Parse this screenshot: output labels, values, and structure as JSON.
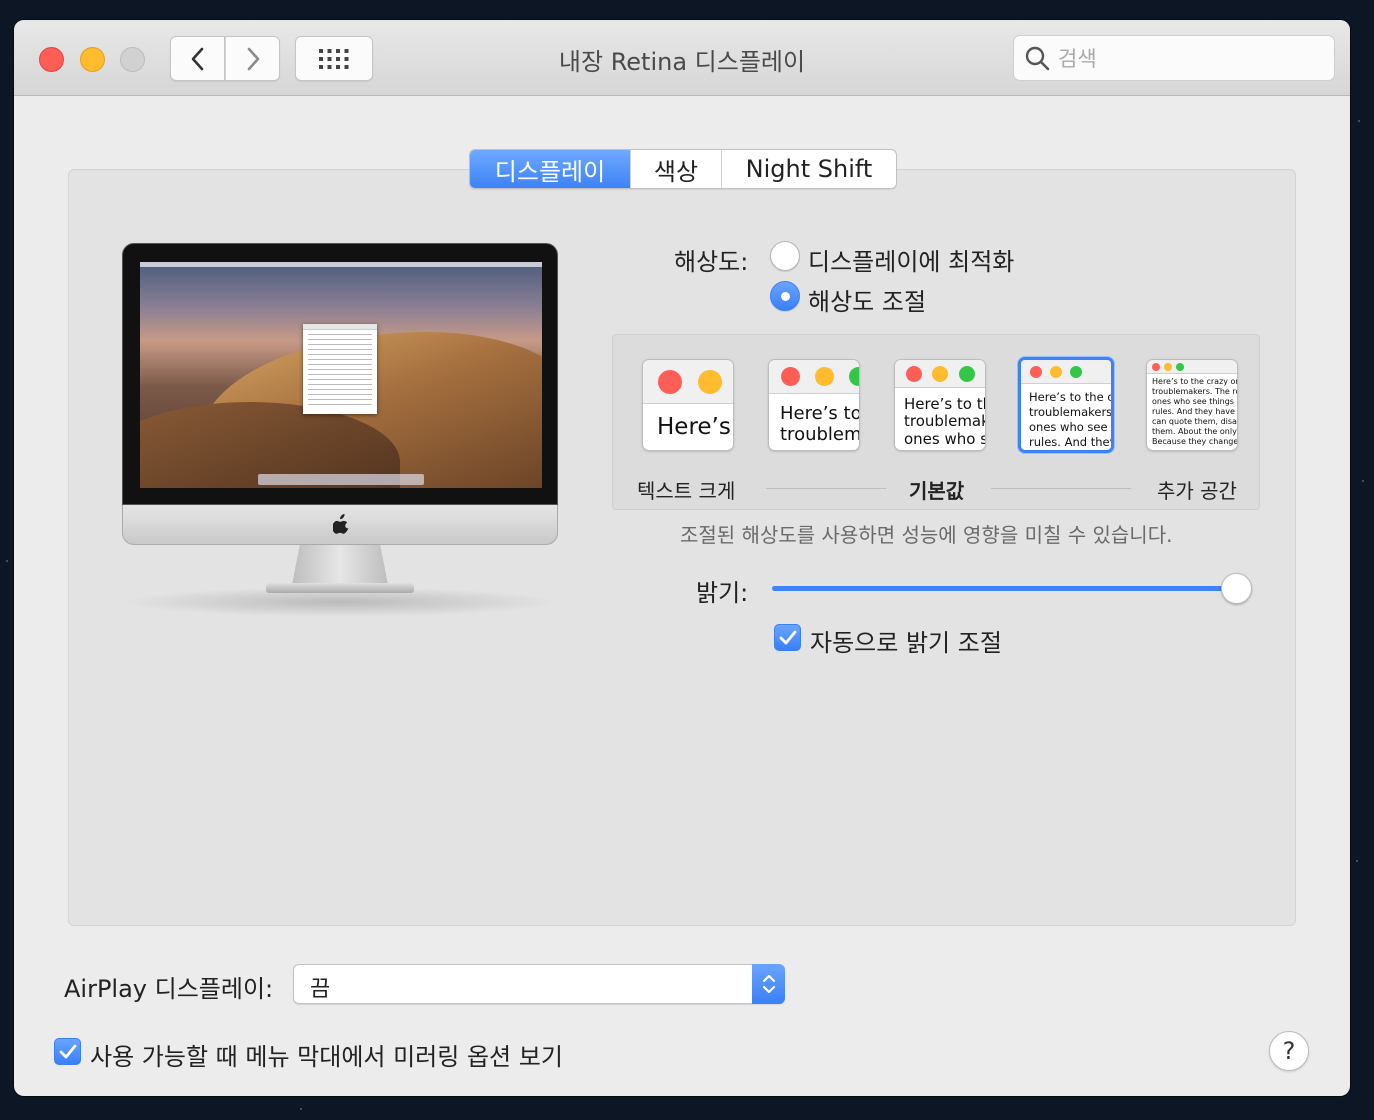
{
  "window": {
    "title": "내장 Retina 디스플레이",
    "search_placeholder": "검색"
  },
  "tabs": [
    {
      "label": "디스플레이",
      "active": true
    },
    {
      "label": "색상",
      "active": false
    },
    {
      "label": "Night Shift",
      "active": false
    }
  ],
  "resolution": {
    "label": "해상도:",
    "options": [
      {
        "label": "디스플레이에 최적화",
        "selected": false
      },
      {
        "label": "해상도 조절",
        "selected": true
      }
    ]
  },
  "scaling": {
    "thumbnails": [
      {
        "text": "Here’s",
        "selected": false
      },
      {
        "text": "Here’s to\ntroublem",
        "selected": false
      },
      {
        "text": "Here’s to th\ntroublemak\nones who s",
        "selected": false
      },
      {
        "text": "Here’s to the cr\ntroublemakers.\nones who see t\nrules. And they",
        "selected": true
      },
      {
        "text": "Here’s to the crazy one\ntroublemakers. The rou\nones who see things dil\nrules. And they have no\ncan quote them, disagr\nthem. About the only th\nBecause they change th",
        "selected": false
      }
    ],
    "label_left": "텍스트 크게",
    "label_center": "기본값",
    "label_right": "추가 공간"
  },
  "performance_note": "조절된 해상도를 사용하면 성능에 영향을 미칠 수 있습니다.",
  "brightness": {
    "label": "밝기:",
    "value": 1.0,
    "auto_label": "자동으로 밝기 조절",
    "auto_checked": true
  },
  "airplay": {
    "label": "AirPlay 디스플레이:",
    "value": "끔"
  },
  "mirroring": {
    "label": "사용 가능할 때 메뉴 막대에서 미러링 옵션 보기",
    "checked": true
  },
  "help_label": "?",
  "colors": {
    "accent": "#3d82f6",
    "close": "#fd5f57",
    "minimize": "#febc2e",
    "zoom_disabled": "#d1d1d1",
    "thumb_green": "#33c748"
  },
  "icons": [
    "back-chevron-icon",
    "forward-chevron-icon",
    "grid-icon",
    "search-icon",
    "apple-logo-icon",
    "checkmark-icon",
    "updown-arrows-icon"
  ]
}
